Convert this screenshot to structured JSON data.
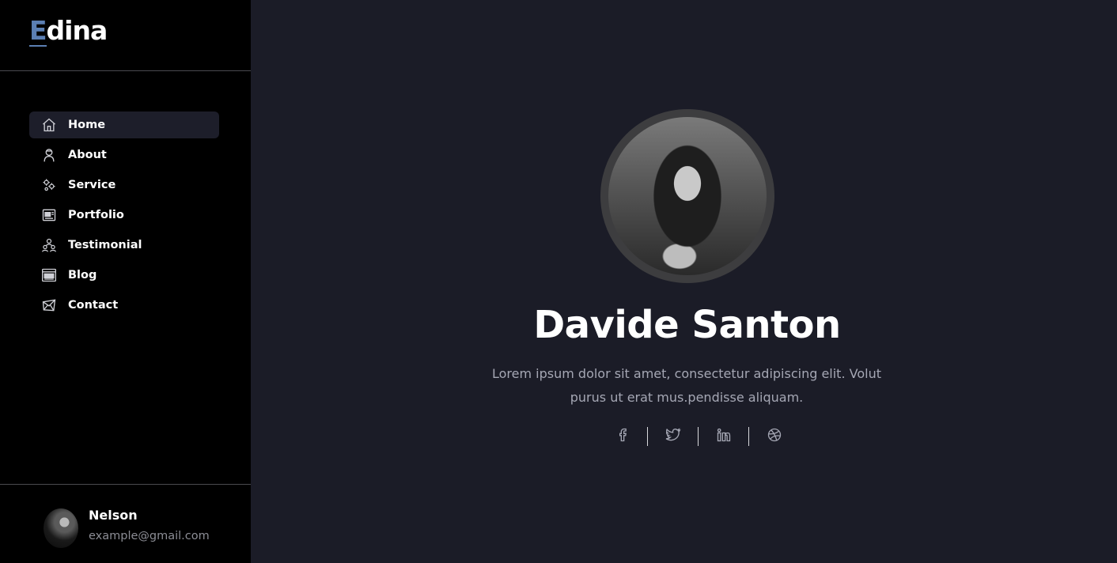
{
  "brand": {
    "first_letter": "E",
    "rest": "dina"
  },
  "nav": {
    "items": [
      {
        "label": "Home",
        "icon": "home-icon",
        "active": true
      },
      {
        "label": "About",
        "icon": "user-icon",
        "active": false
      },
      {
        "label": "Service",
        "icon": "gears-icon",
        "active": false
      },
      {
        "label": "Portfolio",
        "icon": "portfolio-icon",
        "active": false
      },
      {
        "label": "Testimonial",
        "icon": "people-icon",
        "active": false
      },
      {
        "label": "Blog",
        "icon": "blog-icon",
        "active": false
      },
      {
        "label": "Contact",
        "icon": "mail-icon",
        "active": false
      }
    ]
  },
  "profile": {
    "name": "Nelson",
    "email": "example@gmail.com"
  },
  "hero": {
    "name": "Davide Santon",
    "description": "Lorem ipsum dolor sit amet, consectetur adipiscing elit. Volut purus ut erat mus.pendisse aliquam."
  },
  "socials": [
    {
      "icon": "facebook-icon"
    },
    {
      "icon": "twitter-icon"
    },
    {
      "icon": "linkedin-icon"
    },
    {
      "icon": "dribbble-icon"
    }
  ],
  "colors": {
    "sidebar_bg": "#000000",
    "main_bg": "#1b1c27",
    "active_item_bg": "#1d1e2a",
    "logo_accent": "#5b7fb3",
    "description_text": "#a5a7b4"
  }
}
